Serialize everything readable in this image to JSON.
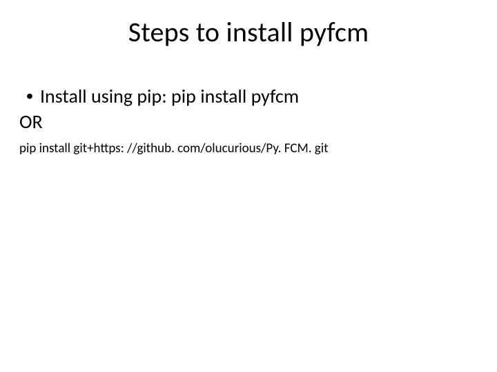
{
  "title": "Steps to install pyfcm",
  "bullet1": {
    "marker": "•",
    "text": "Install using pip:  pip install pyfcm"
  },
  "or_label": "OR",
  "alt_command": "pip install git+https: //github. com/olucurious/Py. FCM. git"
}
